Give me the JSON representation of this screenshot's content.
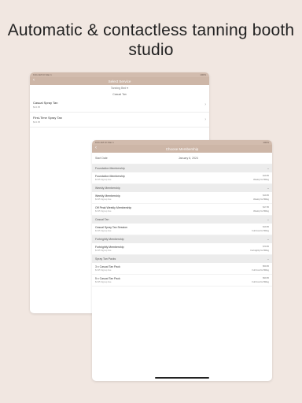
{
  "headline": "Automatic & contactless tanning booth studio",
  "tablet1": {
    "status": {
      "time": "9:41 AM  Fri Mar 1",
      "battery": "100%"
    },
    "nav": {
      "back_icon": "chevron-left",
      "title": "Select Service"
    },
    "filter": "Tanning Bed ▾",
    "section": "Casual Tan",
    "rows": [
      {
        "title": "Casual Spray Tan",
        "price": "$24.95"
      },
      {
        "title": "First-Time Spray Tan",
        "price": "$24.95"
      }
    ]
  },
  "tablet2": {
    "status": {
      "time": "9:41 AM  Fri Mar 1",
      "battery": "100%"
    },
    "nav": {
      "back_icon": "chevron-left",
      "title": "Choose Membership"
    },
    "start": {
      "label": "Start Date",
      "value": "January 6, 2024"
    },
    "sections": [
      {
        "title": "Foundation Membership",
        "items": [
          {
            "name": "Foundation Membership",
            "sub": "$4.95 Signup Fee",
            "price": "$19.95",
            "billing": "Weekly for Billing"
          }
        ]
      },
      {
        "title": "Weekly Membership",
        "items": [
          {
            "name": "Weekly Membership",
            "sub": "$4.95 Signup Fee",
            "price": "$19.95",
            "billing": "Weekly for Billing"
          },
          {
            "name": "Off Peak Weekly Membership",
            "sub": "$4.95 Signup Fee",
            "price": "$17.95",
            "billing": "Weekly for Billing"
          }
        ]
      },
      {
        "title": "Casual Tan",
        "items": [
          {
            "name": "Casual Spray Tan Session",
            "sub": "$4.95 Signup Fee",
            "price": "$19.95",
            "billing": "Full Cost for Billing"
          }
        ]
      },
      {
        "title": "Fortnightly Membership",
        "items": [
          {
            "name": "Fortnightly Membership",
            "sub": "$4.95 Signup Fee",
            "price": "$79.95",
            "billing": "Fortnightly for Billing"
          }
        ]
      },
      {
        "title": "Spray Tan Packs",
        "items": [
          {
            "name": "3 x Casual Tan Pack",
            "sub": "$4.95 Signup Fee",
            "price": "$59.95",
            "billing": "Full Cost for Billing"
          },
          {
            "name": "5 x Casual Tan Pack",
            "sub": "$4.95 Signup Fee",
            "price": "$99.95",
            "billing": "Full Cost for Billing"
          }
        ]
      }
    ]
  }
}
